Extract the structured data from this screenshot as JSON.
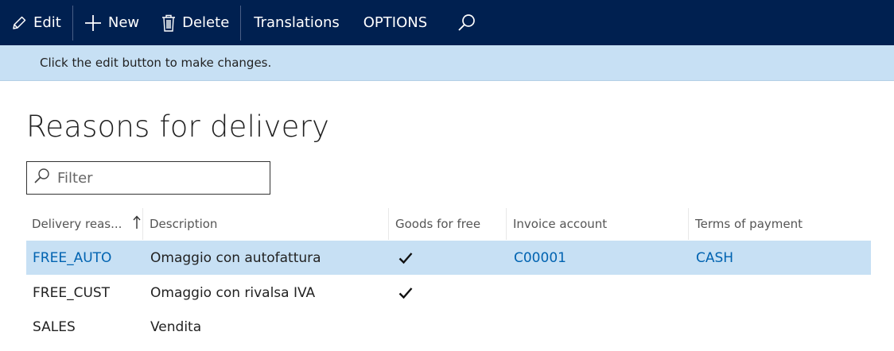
{
  "toolbar": {
    "edit_label": "Edit",
    "new_label": "New",
    "delete_label": "Delete",
    "translations_label": "Translations",
    "options_label": "OPTIONS"
  },
  "notice": {
    "text": "Click the edit button to make changes."
  },
  "page": {
    "title": "Reasons for delivery"
  },
  "filter": {
    "placeholder": "Filter",
    "value": ""
  },
  "grid": {
    "columns": {
      "reason": "Delivery reas...",
      "description": "Description",
      "goods_for_free": "Goods for free",
      "invoice_account": "Invoice account",
      "terms_of_payment": "Terms of payment"
    },
    "sort": {
      "column": "reason",
      "direction": "ascending"
    },
    "rows": [
      {
        "reason": "FREE_AUTO",
        "description": "Omaggio con autofattura",
        "goods_for_free": true,
        "invoice_account": "C00001",
        "terms_of_payment": "CASH",
        "selected": true
      },
      {
        "reason": "FREE_CUST",
        "description": "Omaggio con rivalsa IVA",
        "goods_for_free": true,
        "invoice_account": "",
        "terms_of_payment": "",
        "selected": false
      },
      {
        "reason": "SALES",
        "description": "Vendita",
        "goods_for_free": false,
        "invoice_account": "",
        "terms_of_payment": "",
        "selected": false
      }
    ]
  },
  "colors": {
    "toolbar_bg": "#002050",
    "notice_bg": "#c7e0f4",
    "selected_row_bg": "#c7e0f4",
    "link": "#0063b1"
  }
}
